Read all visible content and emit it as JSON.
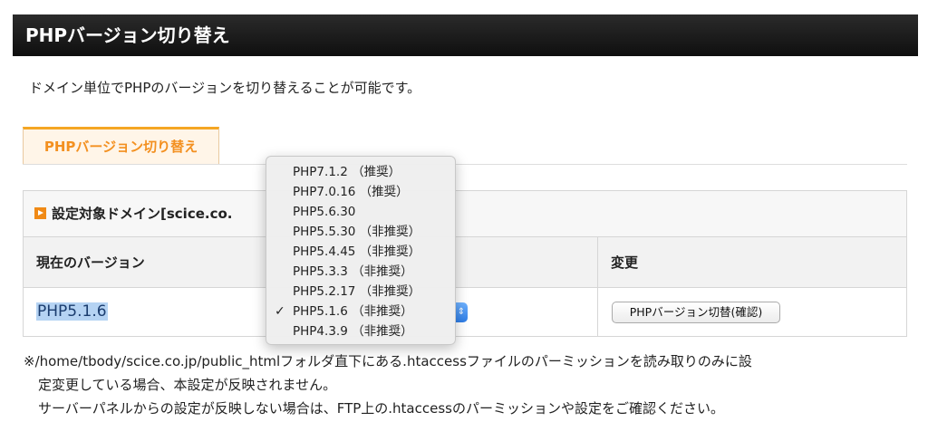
{
  "header": {
    "title": "PHPバージョン切り替え"
  },
  "description": "ドメイン単位でPHPのバージョンを切り替えることが可能です。",
  "tab": {
    "label": "PHPバージョン切り替え"
  },
  "panel": {
    "domain_label": "設定対象ドメイン[scice.co.",
    "col_current": "現在のバージョン",
    "col_change": "変更",
    "current_version": "PHP5.1.6",
    "change_button": "PHPバージョン切替(確認)"
  },
  "dropdown": {
    "selected": "PHP5.1.6 （非推奨）",
    "check_glyph": "✓",
    "options": [
      "PHP7.1.2 （推奨）",
      "PHP7.0.16 （推奨）",
      "PHP5.6.30",
      "PHP5.5.30 （非推奨）",
      "PHP5.4.45 （非推奨）",
      "PHP5.3.3 （非推奨）",
      "PHP5.2.17 （非推奨）",
      "PHP5.1.6 （非推奨）",
      "PHP4.3.9 （非推奨）"
    ]
  },
  "notes": {
    "line1": "※/home/tbody/scice.co.jp/public_htmlフォルダ直下にある.htaccessファイルのパーミッションを読み取りのみに設",
    "line2": "定変更している場合、本設定が反映されません。",
    "line3": "サーバーパネルからの設定が反映しない場合は、FTP上の.htaccessのパーミッションや設定をご確認ください。"
  }
}
